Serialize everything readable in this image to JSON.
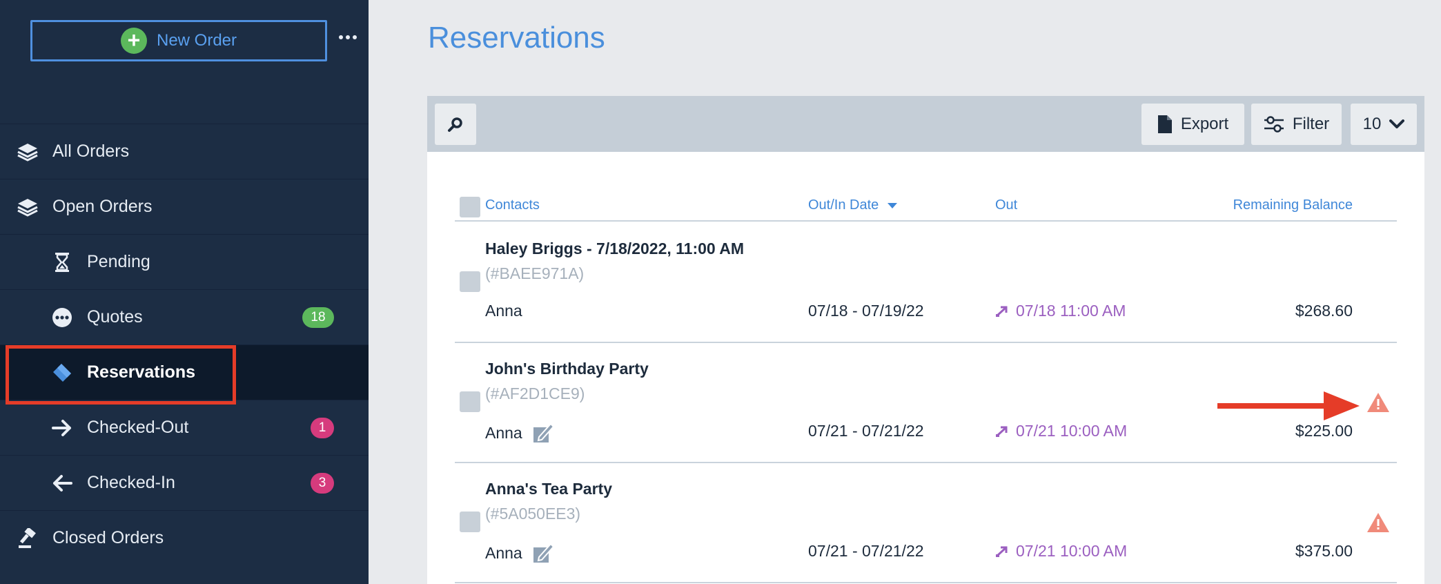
{
  "sidebar": {
    "new_order_label": "New Order",
    "items": [
      {
        "label": "All Orders",
        "icon": "layers-icon"
      },
      {
        "label": "Open Orders",
        "icon": "layers-icon"
      },
      {
        "label": "Pending",
        "icon": "hourglass-icon"
      },
      {
        "label": "Quotes",
        "icon": "ellipsis-circle-icon",
        "badge": "18"
      },
      {
        "label": "Reservations",
        "icon": "tag-icon"
      },
      {
        "label": "Checked-Out",
        "icon": "arrow-right-icon",
        "badge": "1"
      },
      {
        "label": "Checked-In",
        "icon": "arrow-left-icon",
        "badge": "3"
      },
      {
        "label": "Closed Orders",
        "icon": "gavel-icon"
      }
    ]
  },
  "page": {
    "title": "Reservations"
  },
  "toolbar": {
    "export_label": "Export",
    "filter_label": "Filter",
    "page_size": "10"
  },
  "table": {
    "columns": [
      "Contacts",
      "Out/In Date",
      "Out",
      "Remaining Balance"
    ],
    "rows": [
      {
        "title": "Haley Briggs - 7/18/2022, 11:00 AM",
        "code": "(#BAEE971A)",
        "contact": "Anna",
        "dates": "07/18 - 07/19/22",
        "out": "07/18 11:00 AM",
        "balance": "$268.60",
        "warning": false,
        "signed": false
      },
      {
        "title": "John's Birthday Party",
        "code": "(#AF2D1CE9)",
        "contact": "Anna",
        "dates": "07/21 - 07/21/22",
        "out": "07/21 10:00 AM",
        "balance": "$225.00",
        "warning": true,
        "signed": true
      },
      {
        "title": "Anna's Tea Party",
        "code": "(#5A050EE3)",
        "contact": "Anna",
        "dates": "07/21 - 07/21/22",
        "out": "07/21 10:00 AM",
        "balance": "$375.00",
        "warning": true,
        "signed": true
      }
    ]
  },
  "colors": {
    "sidebar_bg": "#1c2d44",
    "accent": "#4a8fdc",
    "out_purple": "#9b5fc0",
    "warning": "#f08a7a",
    "highlight": "#e53c28"
  }
}
